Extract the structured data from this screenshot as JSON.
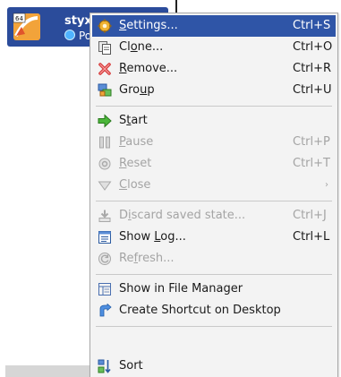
{
  "vm": {
    "name": "styx (",
    "state": "Po",
    "os_badge": "64"
  },
  "menu": {
    "items": [
      {
        "key": "settings",
        "pre": "",
        "u": "S",
        "post": "ettings...",
        "shortcut": "Ctrl+S",
        "icon": "gear-icon",
        "disabled": false,
        "highlight": true
      },
      {
        "key": "clone",
        "pre": "Cl",
        "u": "o",
        "post": "ne...",
        "shortcut": "Ctrl+O",
        "icon": "clone-icon",
        "disabled": false
      },
      {
        "key": "remove",
        "pre": "",
        "u": "R",
        "post": "emove...",
        "shortcut": "Ctrl+R",
        "icon": "remove-icon",
        "disabled": false
      },
      {
        "key": "group",
        "pre": "Gro",
        "u": "u",
        "post": "p",
        "shortcut": "Ctrl+U",
        "icon": "group-icon",
        "disabled": false
      },
      {
        "key": "start",
        "pre": "S",
        "u": "t",
        "post": "art",
        "shortcut": "",
        "icon": "start-arrow-icon",
        "disabled": false
      },
      {
        "key": "pause",
        "pre": "",
        "u": "P",
        "post": "ause",
        "shortcut": "Ctrl+P",
        "icon": "pause-icon",
        "disabled": true
      },
      {
        "key": "reset",
        "pre": "",
        "u": "R",
        "post": "eset",
        "shortcut": "Ctrl+T",
        "icon": "reset-icon",
        "disabled": true
      },
      {
        "key": "close",
        "pre": "",
        "u": "C",
        "post": "lose",
        "shortcut": "",
        "icon": "close-icon",
        "disabled": true,
        "submenu": true
      },
      {
        "key": "discard",
        "pre": "D",
        "u": "i",
        "post": "scard saved state...",
        "shortcut": "Ctrl+J",
        "icon": "discard-icon",
        "disabled": true
      },
      {
        "key": "showlog",
        "pre": "Show ",
        "u": "L",
        "post": "og...",
        "shortcut": "Ctrl+L",
        "icon": "log-icon",
        "disabled": false
      },
      {
        "key": "refresh",
        "pre": "Re",
        "u": "f",
        "post": "resh...",
        "shortcut": "",
        "icon": "refresh-icon",
        "disabled": true
      },
      {
        "key": "filemanager",
        "pre": "Show in File Manager",
        "u": "",
        "post": "",
        "shortcut": "",
        "icon": "file-manager-icon",
        "disabled": false
      },
      {
        "key": "shortcut",
        "pre": "Create Shortcut on Desktop",
        "u": "",
        "post": "",
        "shortcut": "",
        "icon": "shortcut-icon",
        "disabled": false
      },
      {
        "key": "sort",
        "pre": "Sort",
        "u": "",
        "post": "",
        "shortcut": "",
        "icon": "sort-icon",
        "disabled": false
      }
    ],
    "submenu_glyph": "›"
  },
  "colors": {
    "highlight": "#2f55a7",
    "disabled_text": "#a4a4a4",
    "menu_bg": "#f3f3f3"
  }
}
